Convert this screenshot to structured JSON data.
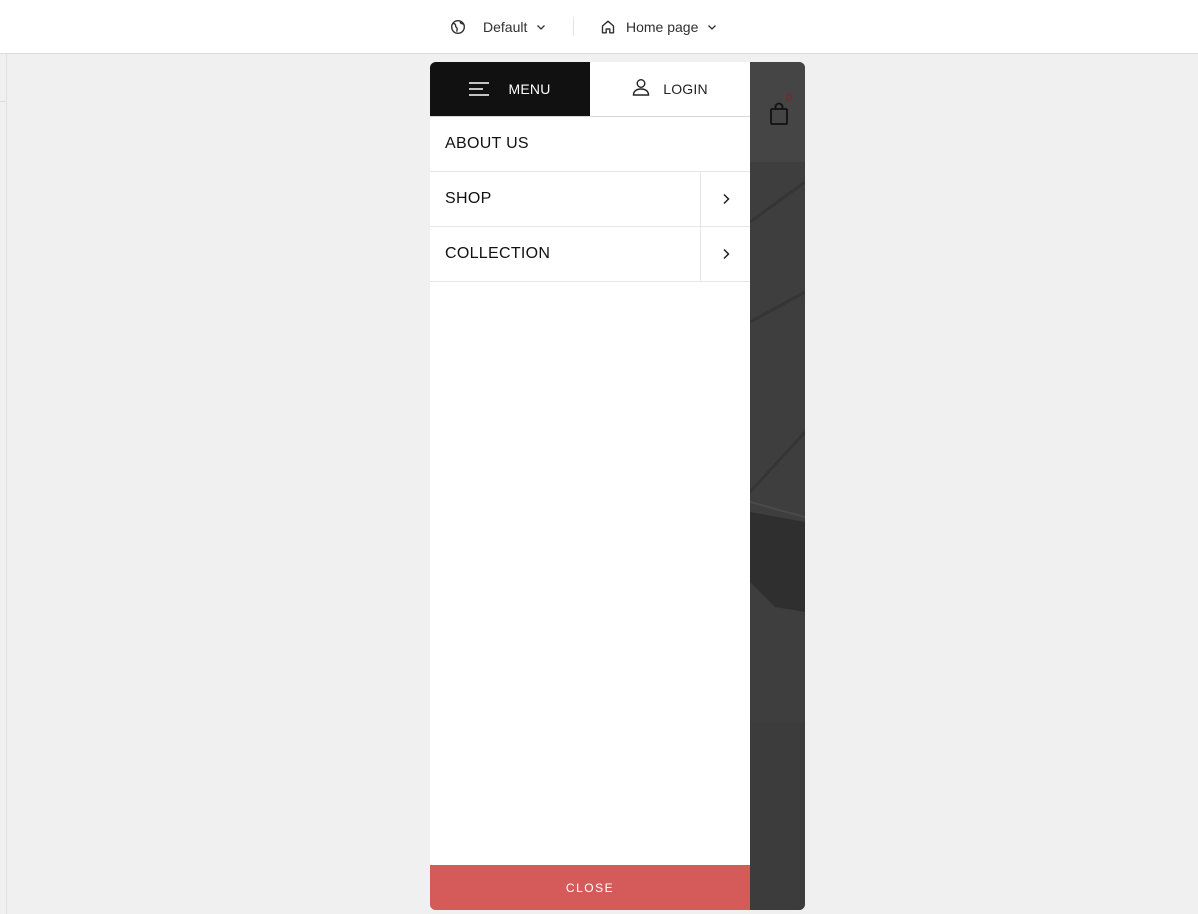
{
  "toolbar": {
    "locale": {
      "label": "Default",
      "icon": "globe-icon"
    },
    "page": {
      "label": "Home page",
      "icon": "home-icon"
    }
  },
  "drawer": {
    "tabs": [
      {
        "label": "MENU",
        "icon": "hamburger-icon",
        "active": true
      },
      {
        "label": "LOGIN",
        "icon": "user-icon",
        "active": false
      }
    ],
    "items": [
      {
        "label": "ABOUT US",
        "has_submenu": false
      },
      {
        "label": "SHOP",
        "has_submenu": true
      },
      {
        "label": "COLLECTION",
        "has_submenu": true
      }
    ],
    "close_label": "CLOSE"
  },
  "store_header": {
    "cart_count": "0",
    "cart_icon": "shopping-bag-icon"
  },
  "colors": {
    "toolbar_bg": "#ffffff",
    "canvas_bg": "#f0f0f0",
    "menu_tab_bg": "#111111",
    "close_button_bg": "#d55b5b",
    "overlay_bg": "#3b3b3b"
  }
}
